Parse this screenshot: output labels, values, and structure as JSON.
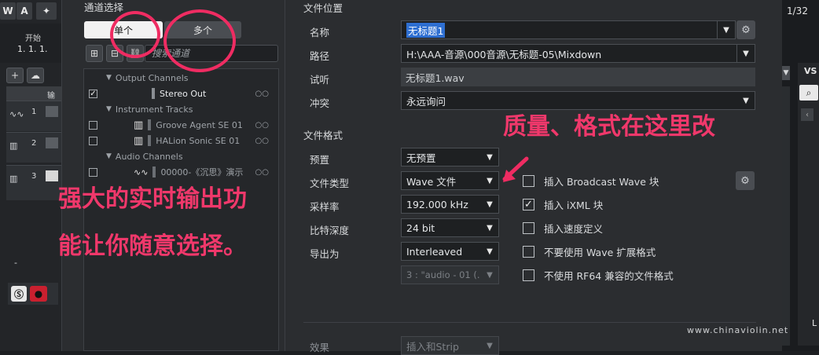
{
  "daw": {
    "top_buttons": [
      "W",
      "A"
    ],
    "ruler_label": "开始",
    "ruler_position": "1. 1. 1.",
    "track_numbers": [
      "1",
      "2",
      "3"
    ],
    "track_header_label": "输",
    "minus_label": "-",
    "right_counter": "1/32",
    "right_label": "VS",
    "right_bottom_letter": "L"
  },
  "channel": {
    "section_title": "通道选择",
    "tabs": [
      {
        "label": "单个",
        "active": true
      },
      {
        "label": "多个",
        "active": false
      }
    ],
    "search_placeholder": "搜索通道",
    "tree": [
      {
        "type": "group",
        "label": "Output Channels"
      },
      {
        "type": "item",
        "label": "Stereo Out",
        "checked": true,
        "bright": true
      },
      {
        "type": "group",
        "label": "Instrument Tracks"
      },
      {
        "type": "item",
        "label": "Groove Agent SE 01",
        "checked": false,
        "icon": "piano-icon"
      },
      {
        "type": "item",
        "label": "HALion Sonic SE 01",
        "checked": false,
        "icon": "piano-icon"
      },
      {
        "type": "group",
        "label": "Audio Channels"
      },
      {
        "type": "item",
        "label": "00000-《沉思》演示",
        "checked": false,
        "icon": "waveform-icon"
      }
    ]
  },
  "file_location": {
    "section_title": "文件位置",
    "name_label": "名称",
    "name_value": "无标题1",
    "path_label": "路径",
    "path_value": "H:\\AAA-音源\\000音源\\无标题-05\\Mixdown",
    "preview_label": "试听",
    "preview_value": "无标题1.wav",
    "conflict_label": "冲突",
    "conflict_value": "永远询问"
  },
  "file_format": {
    "section_title": "文件格式",
    "preset_label": "预置",
    "preset_value": "无预置",
    "filetype_label": "文件类型",
    "filetype_value": "Wave 文件",
    "samplerate_label": "采样率",
    "samplerate_value": "192.000 kHz",
    "bitdepth_label": "比特深度",
    "bitdepth_value": "24 bit",
    "export_label": "导出为",
    "export_value": "Interleaved",
    "channel_value": "3 : \"audio - 01 (.",
    "options": [
      {
        "label": "插入 Broadcast Wave 块",
        "checked": false
      },
      {
        "label": "插入 iXML 块",
        "checked": true
      },
      {
        "label": "插入速度定义",
        "checked": false
      },
      {
        "label": "不要使用 Wave 扩展格式",
        "checked": false
      },
      {
        "label": "不使用 RF64 兼容的文件格式",
        "checked": false
      }
    ],
    "effect_label": "效果",
    "effect_value": "插入和Strip"
  },
  "annotations": {
    "top_right": "质量、格式在这里改",
    "left_line1": "强大的实时输出功",
    "left_line2": "能让你随意选择。"
  },
  "watermark": "www.chinaviolin.net",
  "colors": {
    "accent_red": "#f0386b",
    "selection_blue": "#2e6fd1"
  }
}
